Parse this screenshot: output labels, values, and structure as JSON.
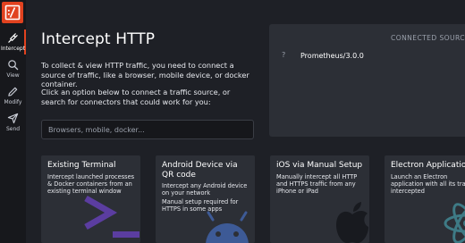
{
  "sidebar": {
    "items": [
      {
        "label": "Intercept",
        "icon": "plug-icon",
        "active": true
      },
      {
        "label": "View",
        "icon": "search-icon",
        "active": false
      },
      {
        "label": "Modify",
        "icon": "pencil-icon",
        "active": false
      },
      {
        "label": "Send",
        "icon": "send-icon",
        "active": false
      }
    ]
  },
  "main": {
    "title": "Intercept HTTP",
    "intro1": "To collect & view HTTP traffic, you need to connect a source of traffic, like a browser, mobile device, or docker container.",
    "intro2": "Click an option below to connect a traffic source, or search for connectors that could work for you:",
    "search_placeholder": "Browsers, mobile, docker..."
  },
  "connected": {
    "heading": "CONNECTED SOURCES",
    "sources": [
      {
        "icon": "?",
        "name": "Prometheus/3.0.0"
      }
    ]
  },
  "cards": [
    {
      "title": "Existing Terminal",
      "desc": "Intercept launched processes & Docker containers from an existing terminal window",
      "desc2": ""
    },
    {
      "title": "Android Device via QR code",
      "desc": "Intercept any Android device on your network",
      "desc2": "Manual setup required for HTTPS in some apps"
    },
    {
      "title": "iOS via Manual Setup",
      "desc": "Manually intercept all HTTP and HTTPS traffic from any iPhone or iPad",
      "desc2": ""
    },
    {
      "title": "Electron Application",
      "desc": "Launch an Electron application with all its traffic intercepted",
      "desc2": ""
    }
  ],
  "colors": {
    "accent": "#e1421f",
    "background": "#1e2026",
    "card": "#2c2f36",
    "sidebar": "#17181c"
  }
}
